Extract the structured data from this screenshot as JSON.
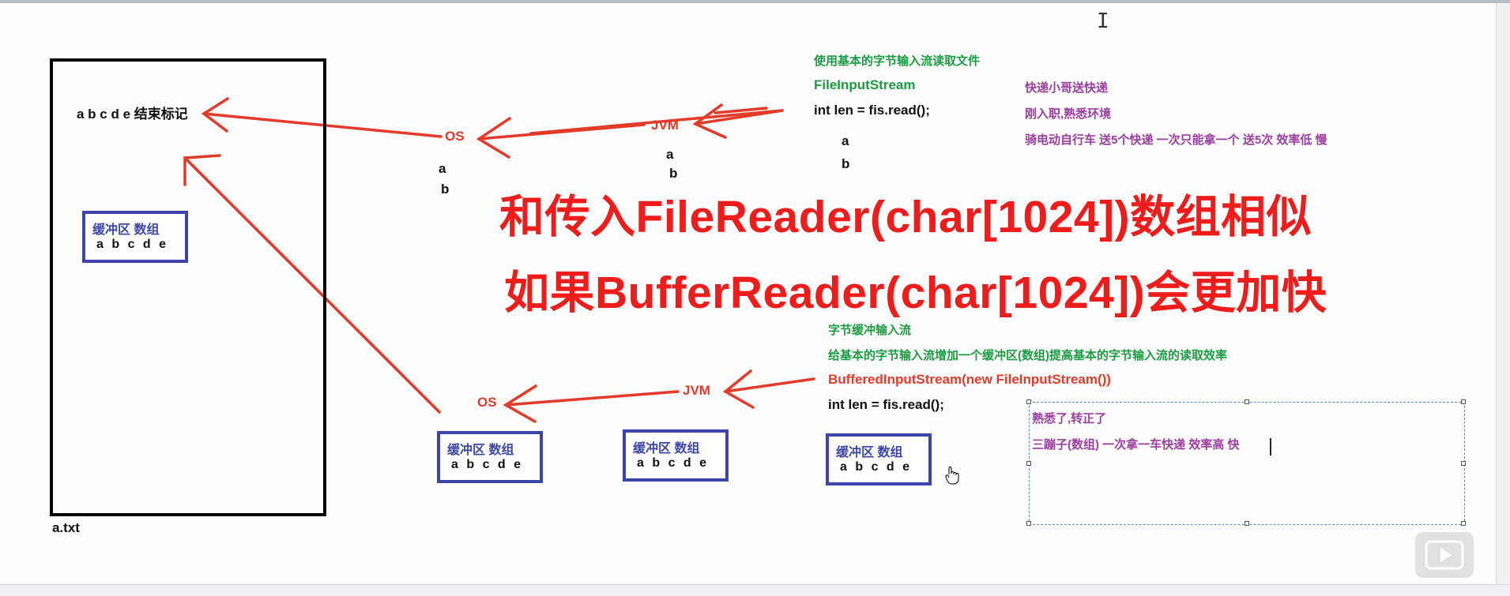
{
  "file": {
    "label": "a.txt",
    "content": "a b c d e 结束标记"
  },
  "buffer_box_label": "缓冲区 数组",
  "buffer_box_content": "a b c d e",
  "top_section": {
    "os_label": "OS",
    "jvm_label": "JVM",
    "os_values": [
      "a",
      "b"
    ],
    "jvm_values": [
      "a",
      "b"
    ],
    "title": "使用基本的字节输入流读取文件",
    "class_name": "FileInputStream",
    "code": "int len = fis.read();",
    "code_values": [
      "a",
      "b"
    ],
    "analogy": [
      "快递小哥送快递",
      "刚入职,熟悉环境",
      "骑电动自行车  送5个快递 一次只能拿一个 送5次  效率低  慢"
    ]
  },
  "big_text": [
    "和传入FileReader(char[1024])数组相似",
    "如果BufferReader(char[1024])会更加快"
  ],
  "bottom_section": {
    "os_label": "OS",
    "jvm_label": "JVM",
    "title": "字节缓冲输入流",
    "description": "给基本的字节输入流增加一个缓冲区(数组)提高基本的字节输入流的读取效率",
    "class_name": "BufferedInputStream(new FileInputStream())",
    "code": "int len = fis.read();",
    "note_lines": [
      "熟悉了,转正了",
      "三蹦子(数组) 一次拿一车快递 效率高 快"
    ]
  },
  "colors": {
    "arrow": "#e33a2a",
    "box_border": "#3b46a8",
    "green": "#1a9c40",
    "purple": "#9b3ea0",
    "big_text": "#ef1c1c"
  },
  "icons": [
    "text-cursor-icon",
    "hand-pointer-icon",
    "play-icon"
  ]
}
